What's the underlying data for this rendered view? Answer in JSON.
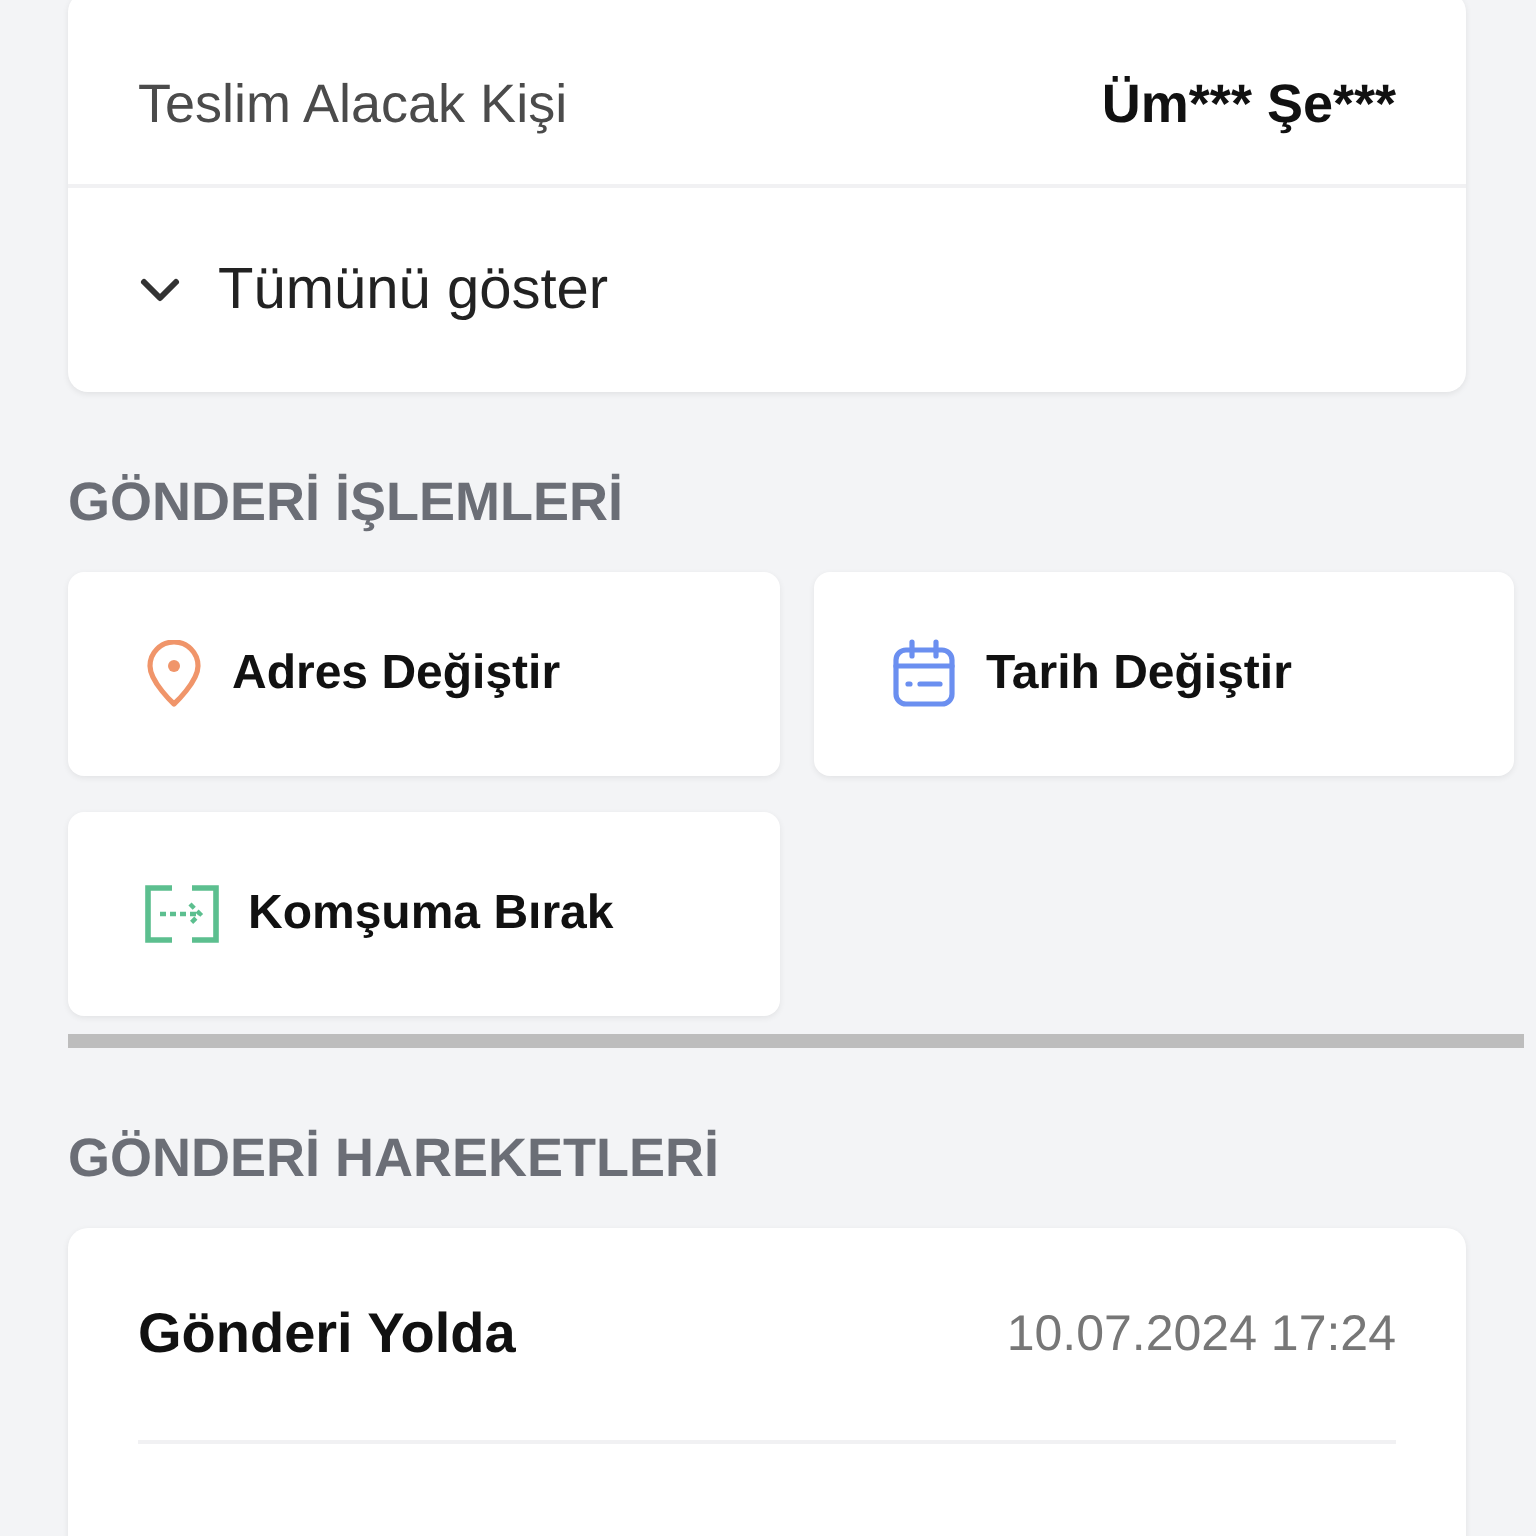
{
  "details": {
    "rows": [
      {
        "label": "Teslim Alacak Kişi",
        "value": "Üm*** Şe***"
      }
    ],
    "toggle": {
      "label": "Tümünü göster",
      "expanded": false
    }
  },
  "actions": {
    "title": "GÖNDERİ İŞLEMLERİ",
    "items": [
      {
        "label": "Adres Değiştir",
        "kind": "address"
      },
      {
        "label": "Tarih Değiştir",
        "kind": "date"
      },
      {
        "label": "Komşuma Bırak",
        "kind": "neighbor"
      }
    ]
  },
  "movements": {
    "title": "GÖNDERİ HAREKETLERİ",
    "current": {
      "status": "Gönderi Yolda",
      "time": "10.07.2024 17:24"
    }
  }
}
